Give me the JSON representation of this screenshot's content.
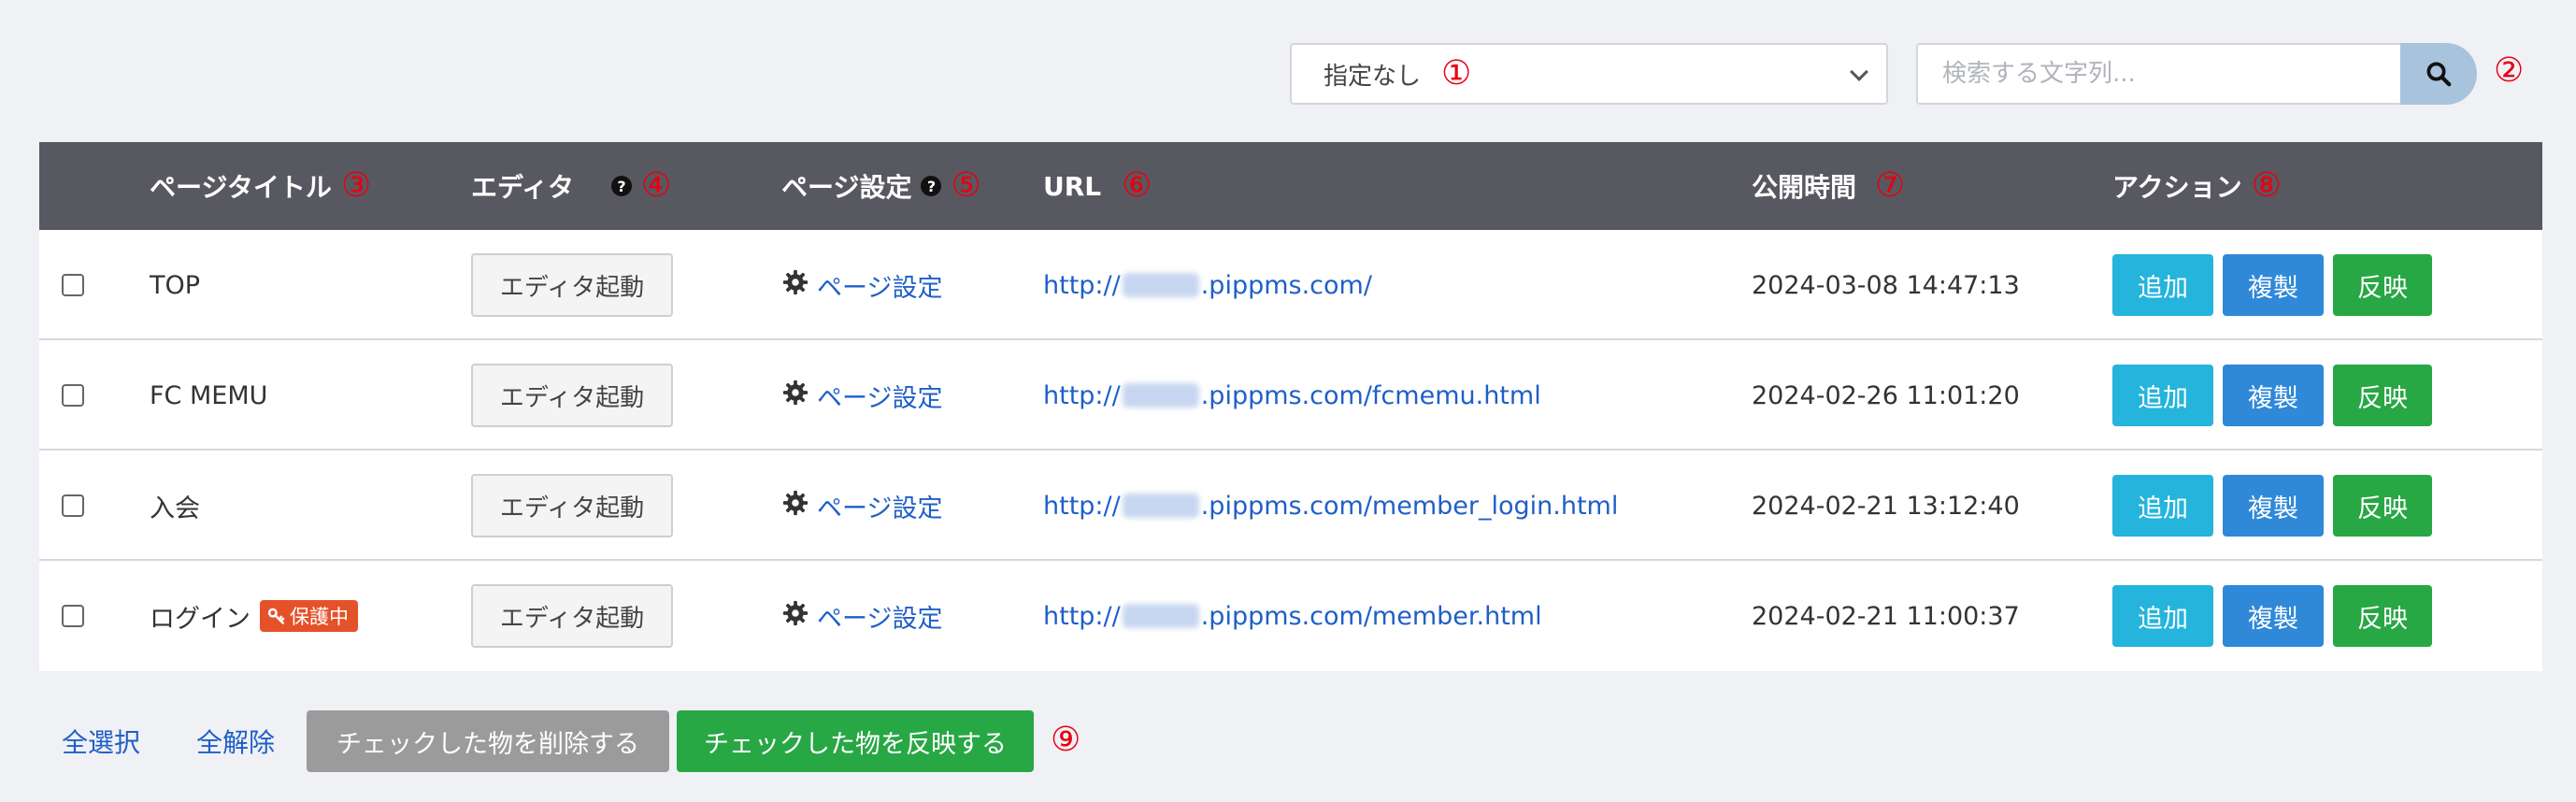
{
  "filter": {
    "selected": "指定なし",
    "marker": "①"
  },
  "search": {
    "placeholder": "検索する文字列...",
    "marker": "②"
  },
  "table": {
    "headers": {
      "title": {
        "label": "ページタイトル",
        "marker": "③"
      },
      "editor": {
        "label": "エディタ",
        "marker": "④"
      },
      "page_settings": {
        "label": "ページ設定",
        "marker": "⑤"
      },
      "url": {
        "label": "URL",
        "marker": "⑥"
      },
      "published": {
        "label": "公開時間",
        "marker": "⑦"
      },
      "actions": {
        "label": "アクション",
        "marker": "⑧"
      }
    },
    "rows": [
      {
        "title": "TOP",
        "badge": "",
        "editor_label": "エディタ起動",
        "settings_label": "ページ設定",
        "url_prefix": "http://",
        "url_suffix": ".pippms.com/",
        "published": "2024-03-08 14:47:13",
        "add": "追加",
        "dup": "複製",
        "reflect": "反映"
      },
      {
        "title": "FC MEMU",
        "badge": "",
        "editor_label": "エディタ起動",
        "settings_label": "ページ設定",
        "url_prefix": "http://",
        "url_suffix": ".pippms.com/fcmemu.html",
        "published": "2024-02-26 11:01:20",
        "add": "追加",
        "dup": "複製",
        "reflect": "反映"
      },
      {
        "title": "入会",
        "badge": "",
        "editor_label": "エディタ起動",
        "settings_label": "ページ設定",
        "url_prefix": "http://",
        "url_suffix": ".pippms.com/member_login.html",
        "published": "2024-02-21 13:12:40",
        "add": "追加",
        "dup": "複製",
        "reflect": "反映"
      },
      {
        "title": "ログイン",
        "badge": "保護中",
        "editor_label": "エディタ起動",
        "settings_label": "ページ設定",
        "url_prefix": "http://",
        "url_suffix": ".pippms.com/member.html",
        "published": "2024-02-21 11:00:37",
        "add": "追加",
        "dup": "複製",
        "reflect": "反映"
      }
    ]
  },
  "footer": {
    "select_all": "全選択",
    "deselect_all": "全解除",
    "delete_checked": "チェックした物を削除する",
    "reflect_checked": "チェックした物を反映する",
    "marker": "⑨"
  },
  "colors": {
    "header_bg": "#585860",
    "add": "#24b4dc",
    "duplicate": "#2f88d8",
    "reflect": "#28a745",
    "delete": "#9b9b9b",
    "badge": "#e5522a",
    "link": "#1f5fc8",
    "marker": "#e60012"
  },
  "icons": [
    "search-icon",
    "question-icon",
    "gear-icon",
    "key-icon",
    "chevron-down-icon"
  ]
}
